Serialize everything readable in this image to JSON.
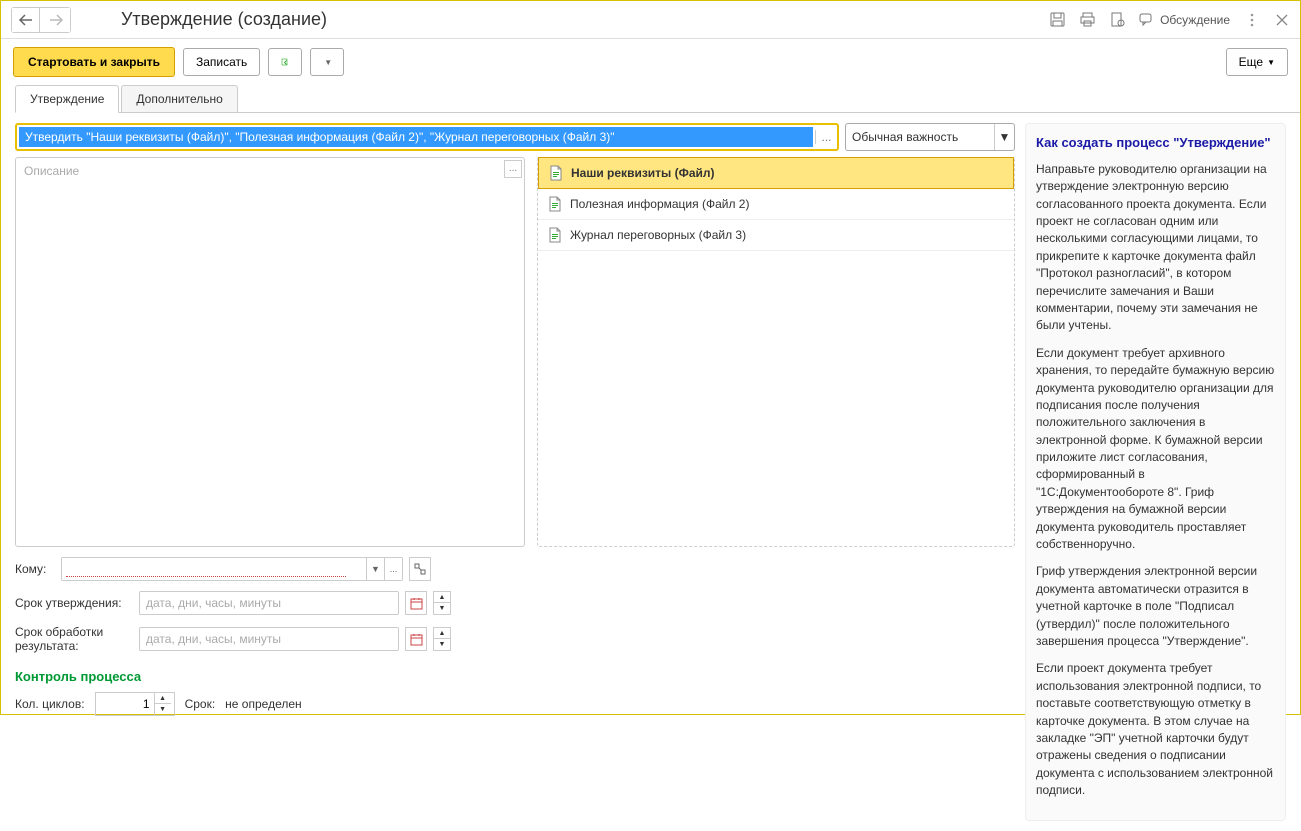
{
  "header": {
    "title": "Утверждение (создание)",
    "discuss_label": "Обсуждение"
  },
  "toolbar": {
    "start_close": "Стартовать и закрыть",
    "write": "Записать",
    "more": "Еще"
  },
  "tabs": {
    "approval": "Утверждение",
    "additional": "Дополнительно"
  },
  "subject": {
    "text": "Утвердить \"Наши реквизиты (Файл)\", \"Полезная информация (Файл 2)\", \"Журнал переговорных (Файл 3)\"",
    "importance": "Обычная важность"
  },
  "description": {
    "placeholder": "Описание"
  },
  "files": [
    {
      "label": "Наши реквизиты (Файл)",
      "selected": true
    },
    {
      "label": "Полезная информация (Файл 2)",
      "selected": false
    },
    {
      "label": "Журнал переговорных (Файл 3)",
      "selected": false
    }
  ],
  "form": {
    "whom_label": "Кому:",
    "approval_deadline_label": "Срок утверждения:",
    "result_deadline_label": "Срок обработки результата:",
    "date_placeholder": "дата, дни, часы, минуты"
  },
  "process_control": {
    "header": "Контроль процесса",
    "cycles_label": "Кол. циклов:",
    "cycles_value": "1",
    "term_label": "Срок:",
    "term_value": "не определен"
  },
  "help": {
    "title": "Как создать процесс \"Утверждение\"",
    "p1": "Направьте руководителю организации на утверждение электронную версию согласованного проекта документа. Если проект не согласован одним или несколькими согласующими лицами, то прикрепите к карточке документа файл \"Протокол разногласий\", в котором перечислите замечания и Ваши комментарии, почему эти замечания не были учтены.",
    "p2": "Если документ требует архивного хранения, то передайте бумажную версию документа руководителю организации для подписания после получения положительного заключения в электронной форме. К бумажной версии приложите лист согласования, сформированный в \"1С:Документообороте 8\". Гриф утверждения на бумажной версии документа руководитель проставляет собственноручно.",
    "p3": "Гриф утверждения электронной версии документа автоматически отразится в учетной карточке в поле \"Подписал (утвердил)\" после положительного завершения процесса \"Утверждение\".",
    "p4": "Если проект документа требует использования электронной подписи, то поставьте соответствующую отметку в карточке документа. В этом случае на закладке \"ЭП\" учетной карточки будут отражены сведения о подписании документа с использованием электронной подписи."
  }
}
